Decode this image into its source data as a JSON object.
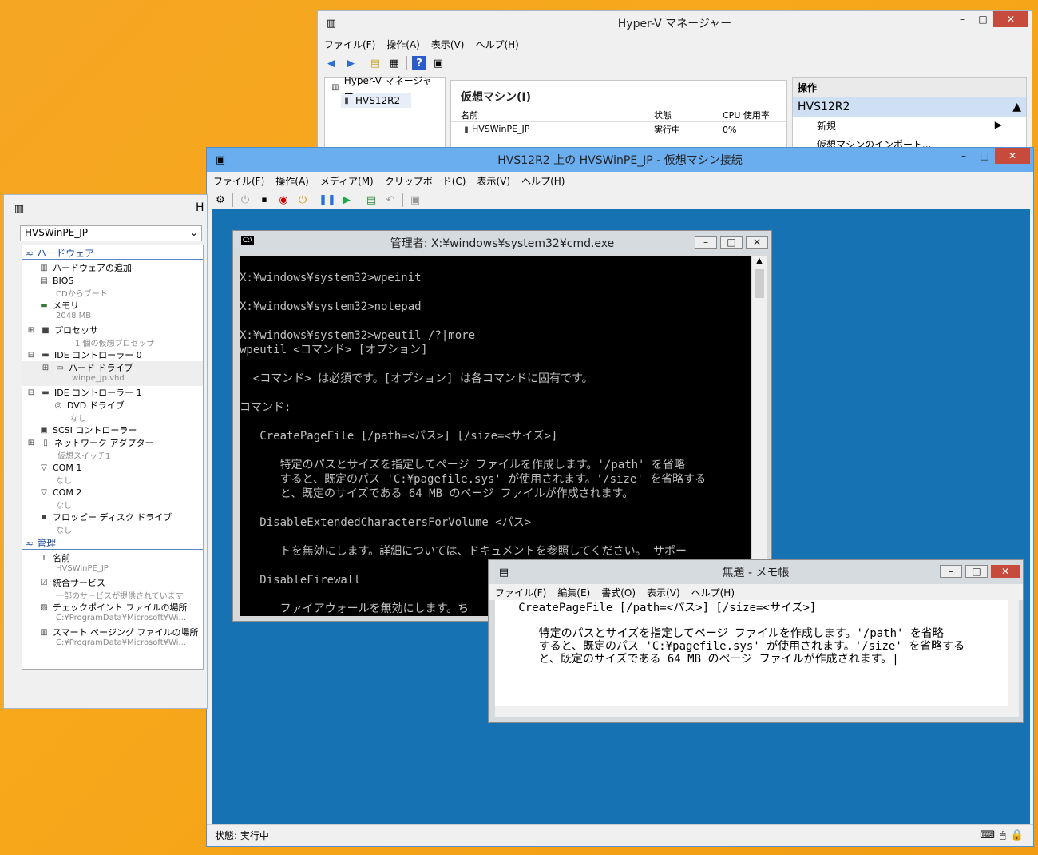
{
  "hyperv_manager": {
    "title": "Hyper-V マネージャー",
    "menu": [
      "ファイル(F)",
      "操作(A)",
      "表示(V)",
      "ヘルプ(H)"
    ],
    "tree": [
      "Hyper-V マネージャー",
      "HVS12R2"
    ],
    "vm_header": "仮想マシン(I)",
    "columns": [
      "名前",
      "状態",
      "CPU 使用率"
    ],
    "vm_row": {
      "name": "HVSWinPE_JP",
      "state": "実行中",
      "cpu": "0%"
    },
    "ops_header": "操作",
    "ops_host": "HVS12R2",
    "ops_items": [
      "新規",
      "仮想マシンのインポート..."
    ]
  },
  "vm_connect": {
    "title": "HVS12R2 上の HVSWinPE_JP - 仮想マシン接続",
    "menu": [
      "ファイル(F)",
      "操作(A)",
      "メディア(M)",
      "クリップボード(C)",
      "表示(V)",
      "ヘルプ(H)"
    ],
    "status": "状態: 実行中"
  },
  "settings": {
    "title": "H",
    "selected_vm": "HVSWinPE_JP",
    "sections": {
      "hardware": "ハードウェア",
      "management": "管理"
    },
    "hardware_items": [
      {
        "label": "ハードウェアの追加",
        "sub": ""
      },
      {
        "label": "BIOS",
        "sub": "CDからブート"
      },
      {
        "label": "メモリ",
        "sub": "2048 MB"
      },
      {
        "label": "プロセッサ",
        "sub": "1 個の仮想プロセッサ"
      },
      {
        "label": "IDE コントローラー 0",
        "sub": ""
      },
      {
        "label": "ハード ドライブ",
        "sub": "winpe_jp.vhd"
      },
      {
        "label": "IDE コントローラー 1",
        "sub": ""
      },
      {
        "label": "DVD ドライブ",
        "sub": "なし"
      },
      {
        "label": "SCSI コントローラー",
        "sub": ""
      },
      {
        "label": "ネットワーク アダプター",
        "sub": "仮想スイッチ1"
      },
      {
        "label": "COM 1",
        "sub": "なし"
      },
      {
        "label": "COM 2",
        "sub": "なし"
      },
      {
        "label": "フロッピー ディスク ドライブ",
        "sub": "なし"
      }
    ],
    "management_items": [
      {
        "label": "名前",
        "sub": "HVSWinPE_JP"
      },
      {
        "label": "統合サービス",
        "sub": "一部のサービスが提供されています"
      },
      {
        "label": "チェックポイント ファイルの場所",
        "sub": "C:¥ProgramData¥Microsoft¥Wi..."
      },
      {
        "label": "スマート ページング ファイルの場所",
        "sub": "C:¥ProgramData¥Microsoft¥Wi..."
      }
    ]
  },
  "cmd": {
    "title": "管理者: X:¥windows¥system32¥cmd.exe",
    "lines": [
      "",
      "X:¥windows¥system32>wpeinit",
      "",
      "X:¥windows¥system32>notepad",
      "",
      "X:¥windows¥system32>wpeutil /?|more",
      "wpeutil <コマンド> [オプション]",
      "",
      "  <コマンド> は必須です。[オプション] は各コマンドに固有です。",
      "",
      "コマンド:",
      "",
      "   CreatePageFile [/path=<パス>] [/size=<サイズ>]",
      "",
      "      特定のパスとサイズを指定してページ ファイルを作成します。'/path' を省略",
      "      すると、既定のパス 'C:¥pagefile.sys' が使用されます。'/size' を省略する",
      "      と、既定のサイズである 64 MB のページ ファイルが作成されます。",
      "",
      "   DisableExtendedCharactersForVolume <パス>",
      "",
      "      トを無効にします。詳細については、ドキュメントを参照してください。 サポー",
      "",
      "   DisableFirewall",
      "",
      "      ファイアウォールを無効にします。ち"
    ]
  },
  "notepad": {
    "title": "無題 - メモ帳",
    "menu": [
      "ファイル(F)",
      "編集(E)",
      "書式(O)",
      "表示(V)",
      "ヘルプ(H)"
    ],
    "lines": [
      "   CreatePageFile [/path=<パス>] [/size=<サイズ>]",
      "",
      "      特定のパスとサイズを指定してページ ファイルを作成します。'/path' を省略",
      "      すると、既定のパス 'C:¥pagefile.sys' が使用されます。'/size' を省略する",
      "      と、既定のサイズである 64 MB のページ ファイルが作成されます。|"
    ]
  }
}
